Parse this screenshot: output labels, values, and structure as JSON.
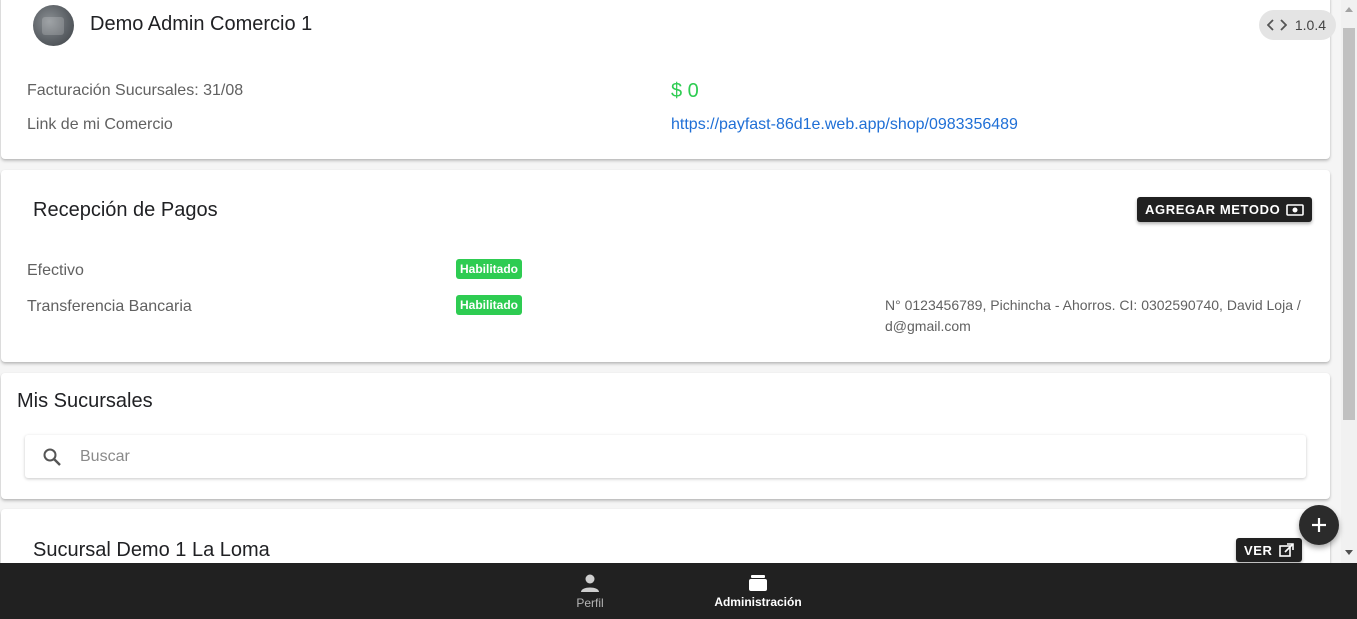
{
  "header": {
    "shop_title": "Demo Admin Comercio 1",
    "version": "1.0.4",
    "billing_label": "Facturación Sucursales: 31/08",
    "billing_amount": "$ 0",
    "link_label": "Link de mi Comercio",
    "link_url": "https://payfast-86d1e.web.app/shop/0983356489"
  },
  "payments": {
    "title": "Recepción de Pagos",
    "add_method_label": "AGREGAR METODO",
    "methods": [
      {
        "name": "Efectivo",
        "status": "Habilitado",
        "details": ""
      },
      {
        "name": "Transferencia Bancaria",
        "status": "Habilitado",
        "details": "N° 0123456789, Pichincha - Ahorros. CI: 0302590740, David Loja / d@gmail.com"
      }
    ]
  },
  "branches": {
    "title": "Mis Sucursales",
    "search_placeholder": "Buscar",
    "items": [
      {
        "name": "Sucursal Demo 1 La Loma",
        "view_label": "VER"
      }
    ]
  },
  "bottom_nav": {
    "items": [
      {
        "label": "Perfil",
        "icon": "person-icon",
        "active": false
      },
      {
        "label": "Administración",
        "icon": "wallet-icon",
        "active": true
      }
    ]
  },
  "colors": {
    "accent_green": "#2ecc52",
    "link_blue": "#1f6fd6",
    "nav_bg": "#212121"
  }
}
